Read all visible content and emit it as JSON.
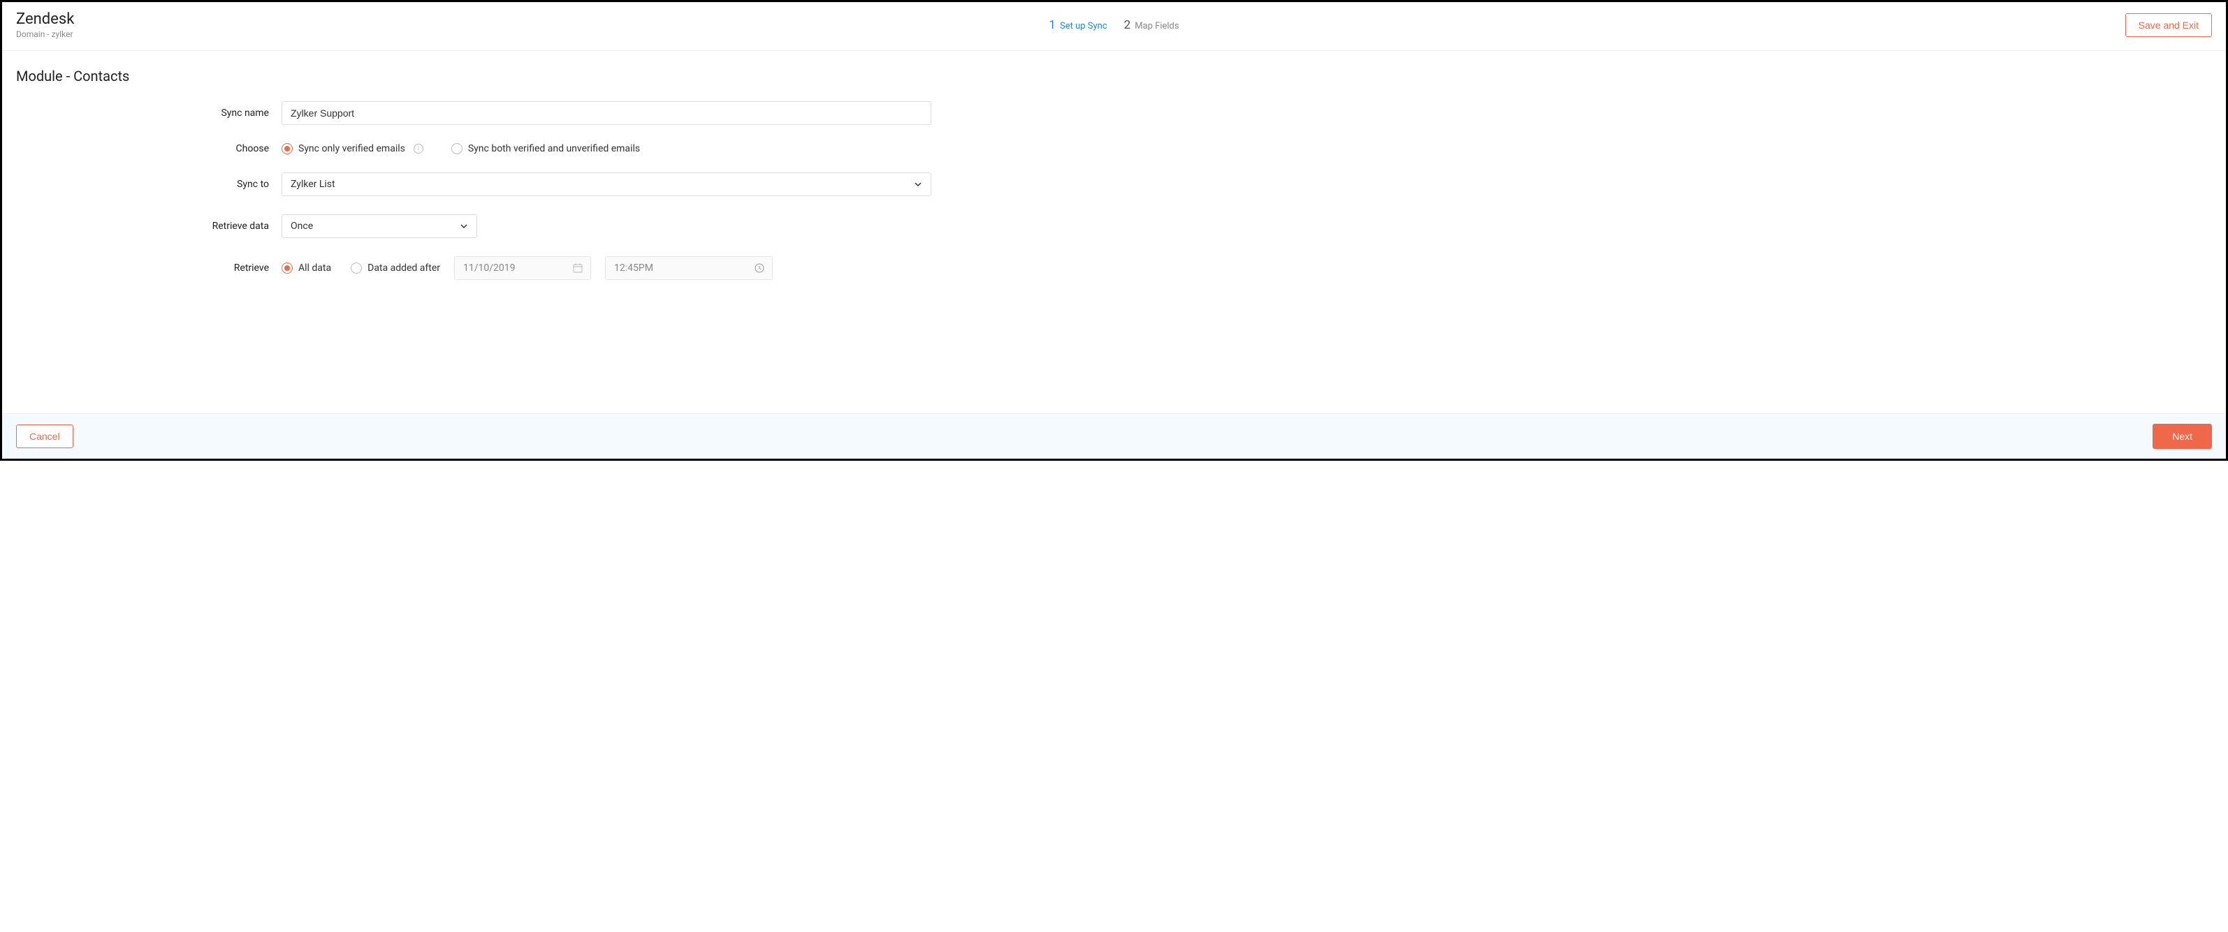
{
  "header": {
    "title": "Zendesk",
    "subtitle": "Domain - zylker",
    "steps": [
      {
        "num": "1",
        "label": "Set up Sync",
        "active": true
      },
      {
        "num": "2",
        "label": "Map Fields",
        "active": false
      }
    ],
    "save_exit": "Save and Exit"
  },
  "section": {
    "title": "Module - Contacts"
  },
  "form": {
    "sync_name_label": "Sync name",
    "sync_name_value": "Zylker Support",
    "choose_label": "Choose",
    "choose_opt1": "Sync only verified emails",
    "choose_opt2": "Sync both verified and unverified emails",
    "sync_to_label": "Sync to",
    "sync_to_value": "Zylker List",
    "retrieve_data_label": "Retrieve data",
    "retrieve_data_value": "Once",
    "retrieve_label": "Retrieve",
    "retrieve_opt1": "All data",
    "retrieve_opt2": "Data added after",
    "date_value": "11/10/2019",
    "time_value": "12:45PM"
  },
  "footer": {
    "cancel": "Cancel",
    "next": "Next"
  }
}
